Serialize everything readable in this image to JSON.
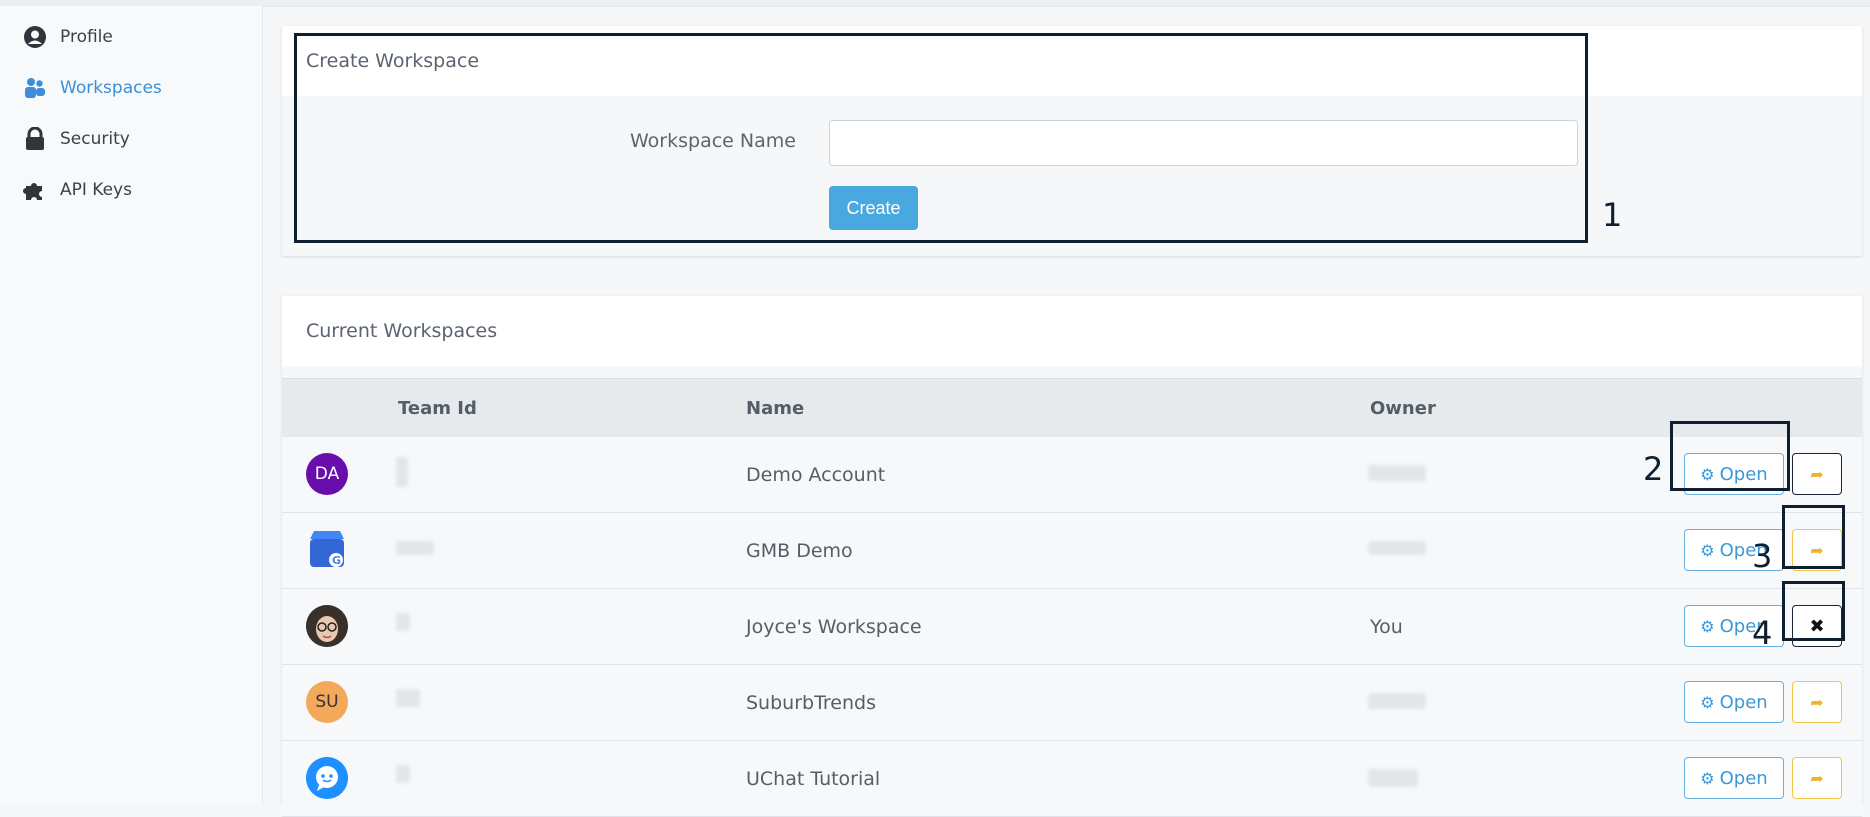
{
  "sidebar": {
    "items": [
      {
        "label": "Profile",
        "icon": "user-circle-icon"
      },
      {
        "label": "Workspaces",
        "icon": "users-icon",
        "active": true
      },
      {
        "label": "Security",
        "icon": "lock-icon"
      },
      {
        "label": "API Keys",
        "icon": "puzzle-icon"
      }
    ]
  },
  "create_panel": {
    "title": "Create Workspace",
    "field_label": "Workspace Name",
    "input_value": "",
    "input_placeholder": "",
    "button_label": "Create"
  },
  "workspaces_panel": {
    "title": "Current Workspaces",
    "columns": [
      "Team Id",
      "Name",
      "Owner"
    ],
    "rows": [
      {
        "avatar_text": "DA",
        "avatar_color": "#6a0dad",
        "name": "Demo Account",
        "owner": "",
        "open_label": "Open",
        "action": "leave"
      },
      {
        "avatar_text": "",
        "avatar_color": "#4285f4",
        "name": "GMB Demo",
        "owner": "",
        "open_label": "Open",
        "action": "leave"
      },
      {
        "avatar_text": "",
        "avatar_color": "#2b2b2b",
        "name": "Joyce's Workspace",
        "owner": "You",
        "open_label": "Open",
        "action": "delete"
      },
      {
        "avatar_text": "SU",
        "avatar_color": "#f4a85a",
        "name": "SuburbTrends",
        "owner": "",
        "open_label": "Open",
        "action": "leave"
      },
      {
        "avatar_text": "",
        "avatar_color": "#1e90ff",
        "name": "UChat Tutorial",
        "owner": "",
        "open_label": "Open",
        "action": "leave"
      }
    ]
  },
  "annotations": [
    "1",
    "2",
    "3",
    "4"
  ],
  "colors": {
    "accent": "#48a8df",
    "active_nav": "#3a8fd8",
    "leave": "#f0b429"
  }
}
